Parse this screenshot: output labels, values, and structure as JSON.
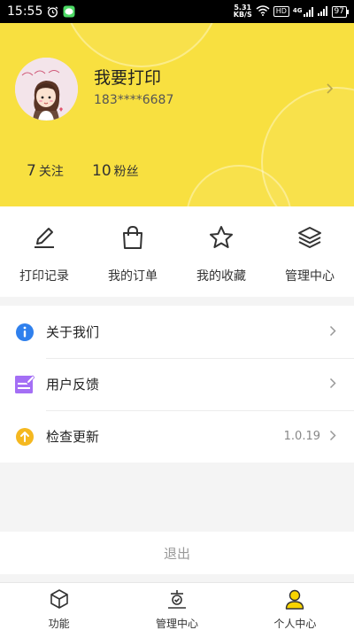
{
  "status_bar": {
    "time": "15:55",
    "net_speed_value": "5.31",
    "net_speed_unit": "KB/S",
    "hd": "HD",
    "signal_gen": "4G",
    "battery": "97"
  },
  "profile": {
    "name": "我要打印",
    "phone": "183****6687",
    "stats": {
      "follow_count": "7",
      "follow_label": "关注",
      "fans_count": "10",
      "fans_label": "粉丝"
    }
  },
  "shortcuts": [
    {
      "label": "打印记录",
      "icon": "pencil-icon"
    },
    {
      "label": "我的订单",
      "icon": "shopping-bag-icon"
    },
    {
      "label": "我的收藏",
      "icon": "star-icon"
    },
    {
      "label": "管理中心",
      "icon": "layers-icon"
    }
  ],
  "menu": [
    {
      "label": "关于我们",
      "icon": "info-icon",
      "color": "#2f80ed"
    },
    {
      "label": "用户反馈",
      "icon": "feedback-icon",
      "color": "#a46ff5"
    },
    {
      "label": "检查更新",
      "icon": "update-icon",
      "color": "#f5b820",
      "value": "1.0.19"
    }
  ],
  "logout_label": "退出",
  "tabbar": [
    {
      "label": "功能",
      "icon": "cube-icon"
    },
    {
      "label": "管理中心",
      "icon": "management-icon"
    },
    {
      "label": "个人中心",
      "icon": "person-icon",
      "active": true
    }
  ],
  "colors": {
    "header_yellow": "#f8e040",
    "active_tab_yellow": "#f8d400"
  }
}
